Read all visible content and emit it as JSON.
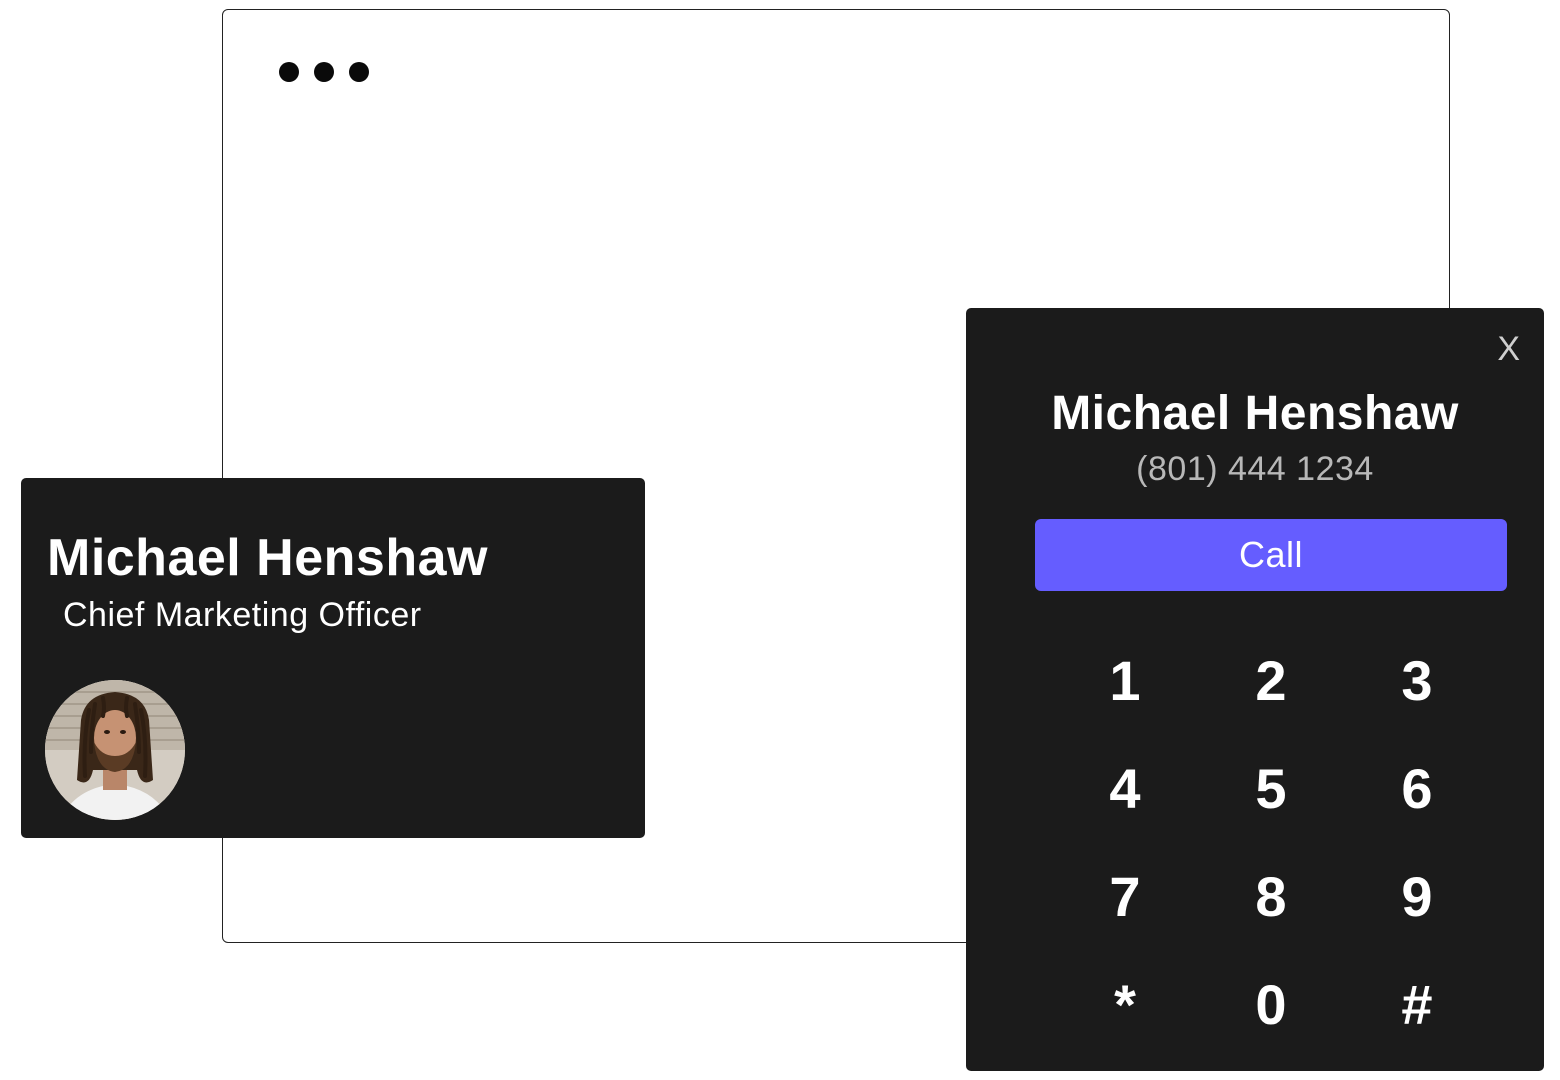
{
  "window": {
    "dots": [
      "dot",
      "dot",
      "dot"
    ]
  },
  "contact_card": {
    "name": "Michael Henshaw",
    "title": "Chief Marketing Officer",
    "avatar": "person-photo"
  },
  "dialer": {
    "close_label": "X",
    "name": "Michael Henshaw",
    "phone": "(801) 444 1234",
    "call_label": "Call",
    "keys": [
      "1",
      "2",
      "3",
      "4",
      "5",
      "6",
      "7",
      "8",
      "9",
      "*",
      "0",
      "#"
    ],
    "accent_color": "#655dff"
  }
}
